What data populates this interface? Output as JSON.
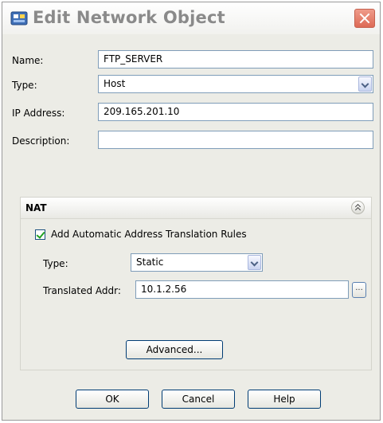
{
  "window": {
    "title": "Edit Network Object",
    "icon": "network-object-icon"
  },
  "form": {
    "name_label": "Name:",
    "name_value": "FTP_SERVER",
    "type_label": "Type:",
    "type_value": "Host",
    "ip_label": "IP Address:",
    "ip_value": "209.165.201.10",
    "description_label": "Description:",
    "description_value": ""
  },
  "nat": {
    "header": "NAT",
    "auto_rules_label": "Add Automatic Address Translation Rules",
    "auto_rules_checked": true,
    "type_label": "Type:",
    "type_value": "Static",
    "translated_label": "Translated Addr:",
    "translated_value": "10.1.2.56",
    "browse_label": "...",
    "advanced_label": "Advanced..."
  },
  "buttons": {
    "ok": "OK",
    "cancel": "Cancel",
    "help": "Help"
  },
  "colors": {
    "accent_border": "#003c74",
    "field_border": "#7f9db9",
    "checkmark": "#21a121"
  }
}
